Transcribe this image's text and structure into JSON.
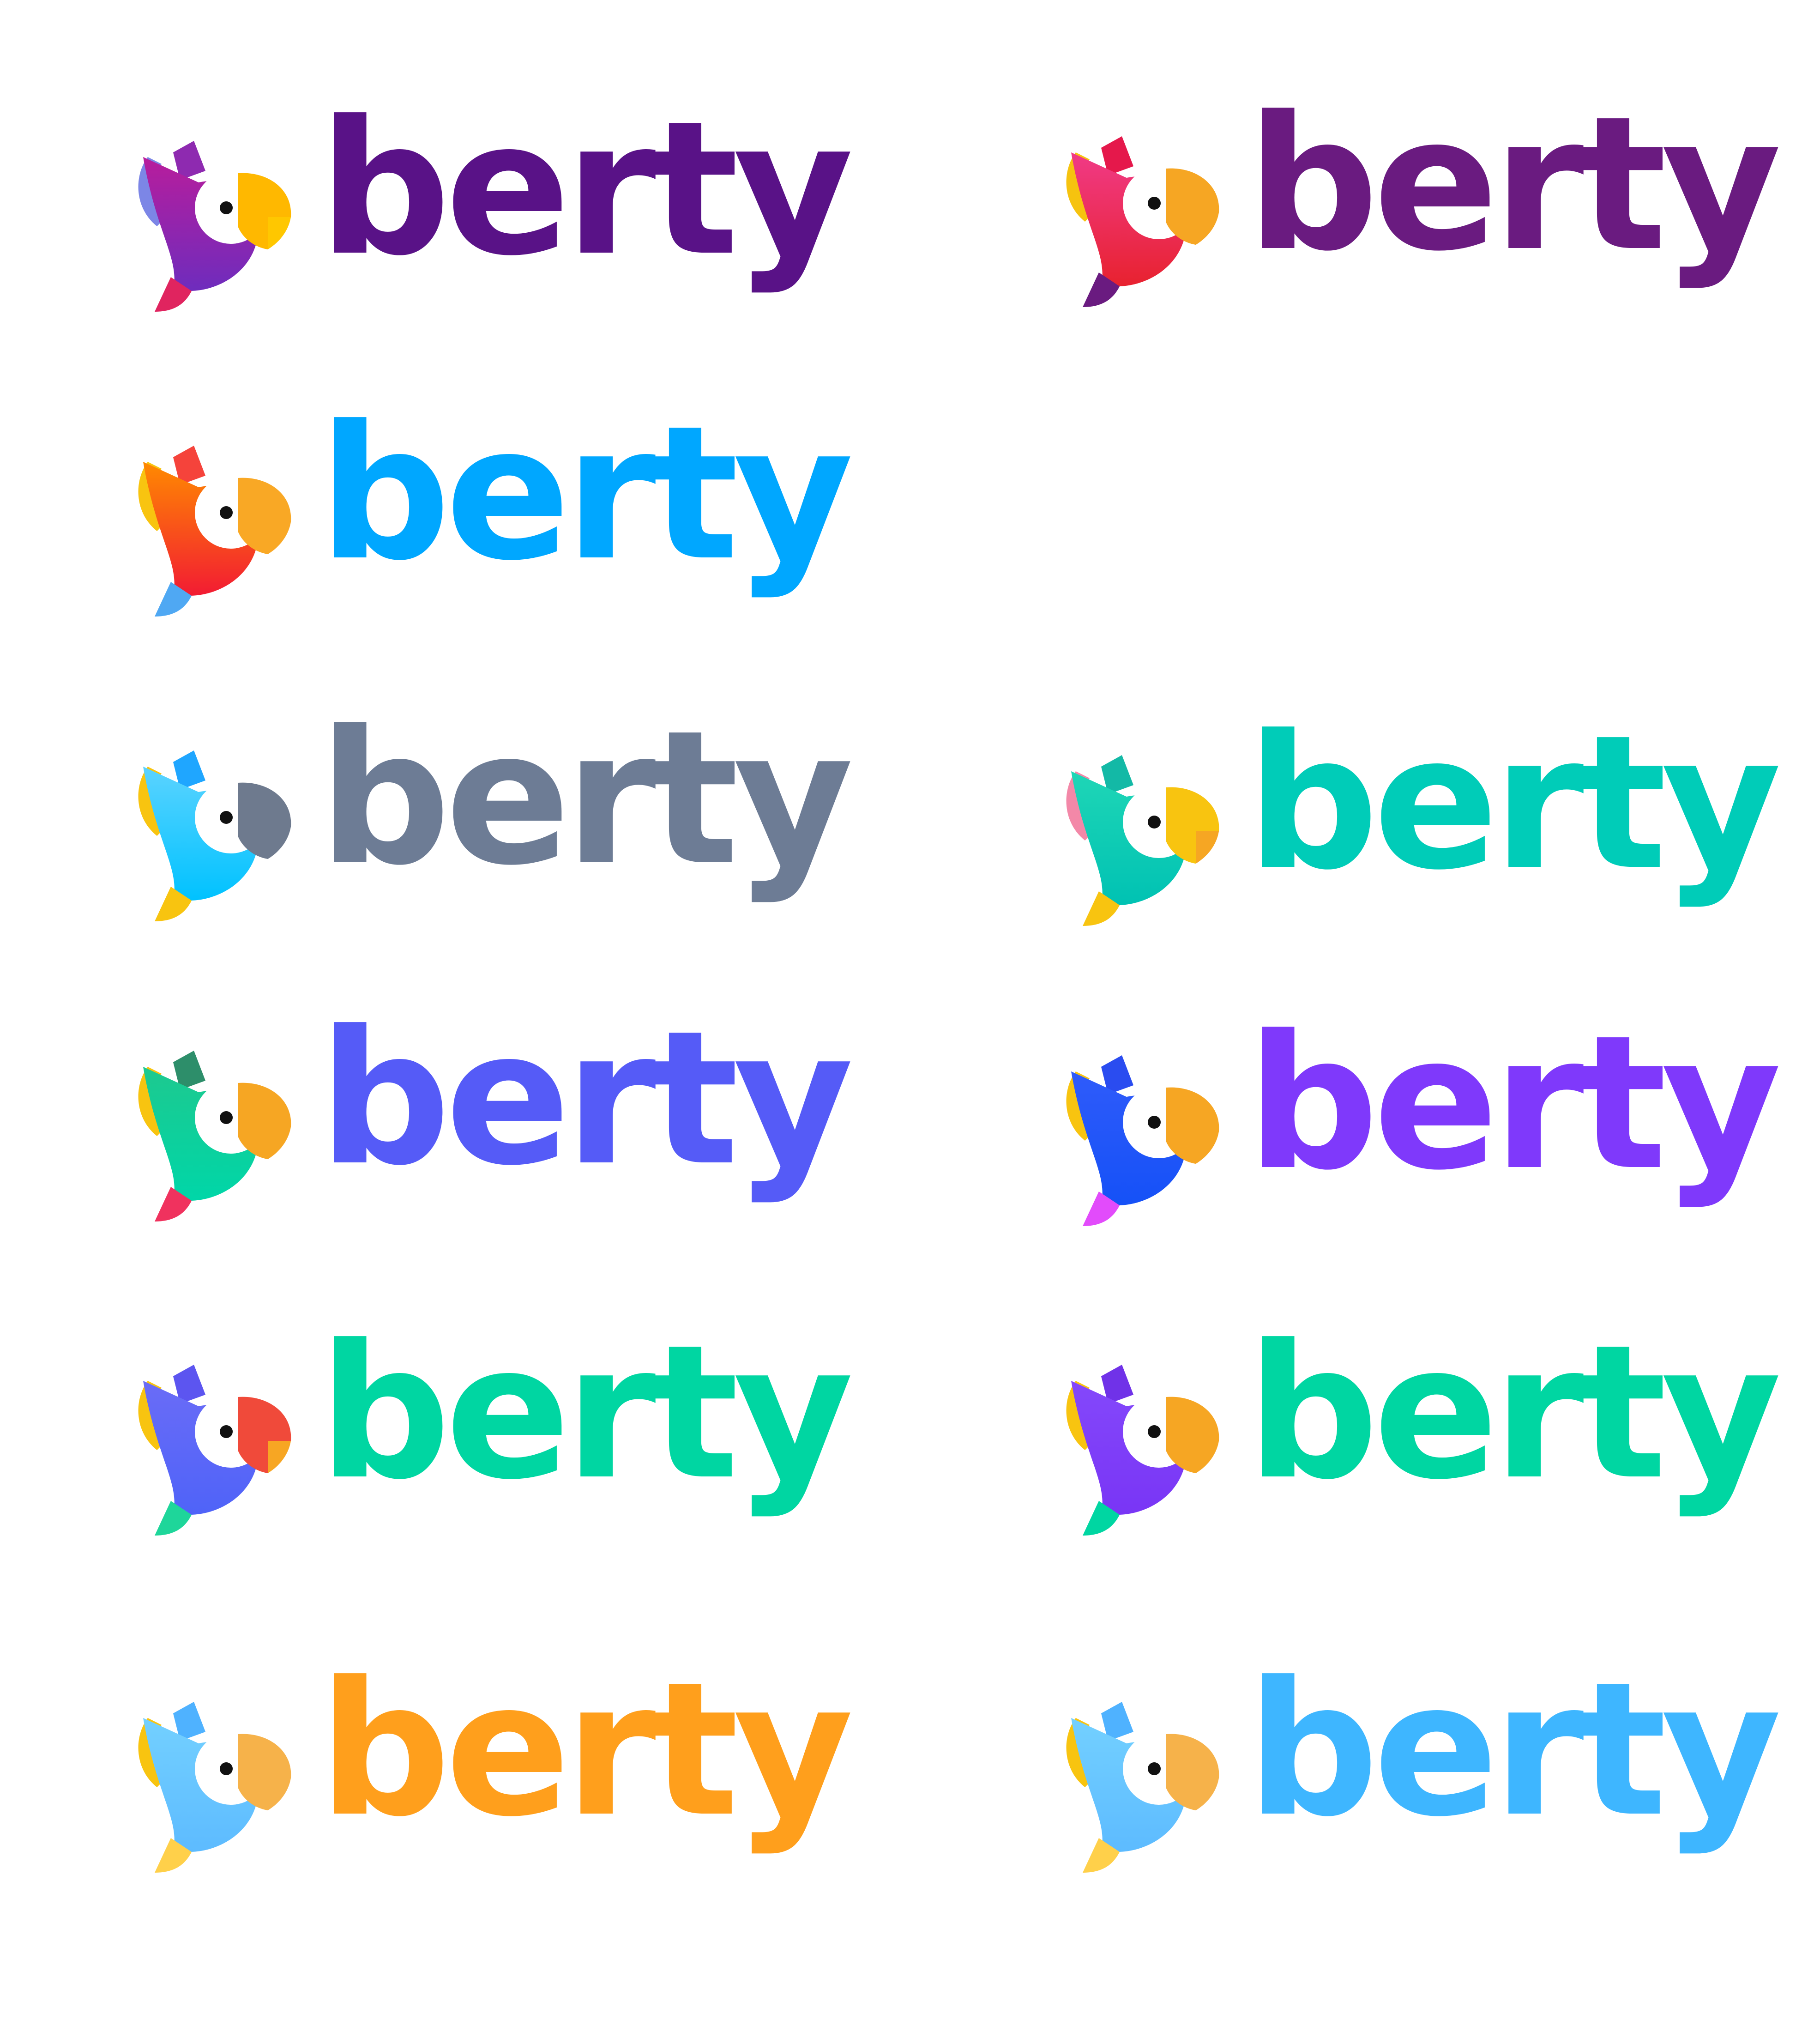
{
  "logos": [
    {
      "text": "berty",
      "text_color": "#591287",
      "body_top": "#B81D9C",
      "body_bottom": "#6E2CBD",
      "wing": "#8E2AB0",
      "crest": "#7C86E6",
      "tail": "#E0245F",
      "beak": "#FFB800",
      "beak_lower": "#FFC700"
    },
    {
      "text": "berty",
      "text_color": "#6A1B80",
      "body_top": "#F03A86",
      "body_bottom": "#E8222F",
      "wing": "#E5184B",
      "crest": "#F6C30F",
      "tail": "#6A1B80",
      "beak": "#F6A623",
      "beak_lower": "#F6A623"
    },
    {
      "text": "berty",
      "text_color": "#00A7FF",
      "body_top": "#FF8A00",
      "body_bottom": "#F21B33",
      "wing": "#F5433B",
      "crest": "#F8C410",
      "tail": "#4FA8F3",
      "beak": "#F9A825",
      "beak_lower": "#F9A825"
    },
    {
      "text": "berty",
      "text_color": "#6D7C95",
      "body_top": "#5BD3FF",
      "body_bottom": "#00C2FF",
      "wing": "#1FA6FF",
      "crest": "#F8C410",
      "tail": "#F8C410",
      "beak": "#6E7A8E",
      "beak_lower": "#6E7A8E"
    },
    {
      "text": "berty",
      "text_color": "#00CCB8",
      "body_top": "#1FD6B6",
      "body_bottom": "#00C2B3",
      "wing": "#13B9A6",
      "crest": "#F388A8",
      "tail": "#F8C410",
      "beak": "#F8C410",
      "beak_lower": "#F6A623"
    },
    {
      "text": "berty",
      "text_color": "#555BF7",
      "body_top": "#1DC98F",
      "body_bottom": "#00D6A8",
      "wing": "#2D8E6A",
      "crest": "#F8C410",
      "tail": "#F0325E",
      "beak": "#F6A623",
      "beak_lower": "#F6A623"
    },
    {
      "text": "berty",
      "text_color": "#7F39FB",
      "body_top": "#2F5BFA",
      "body_bottom": "#1551F7",
      "wing": "#2A4CF0",
      "crest": "#F8C410",
      "tail": "#E24BFB",
      "beak": "#F6A623",
      "beak_lower": "#F6A623"
    },
    {
      "text": "berty",
      "text_color": "#00D6A2",
      "body_top": "#6A6CF7",
      "body_bottom": "#4F63F8",
      "wing": "#5C55F0",
      "crest": "#F8C410",
      "tail": "#1ED69A",
      "beak": "#F04A3A",
      "beak_lower": "#F7A623"
    },
    {
      "text": "berty",
      "text_color": "#00D6A2",
      "body_top": "#8448FB",
      "body_bottom": "#7935F5",
      "wing": "#7032E8",
      "crest": "#F8C410",
      "tail": "#00D6A2",
      "beak": "#F6A623",
      "beak_lower": "#F6A623"
    },
    {
      "text": "berty",
      "text_color": "#FF9F1C",
      "body_top": "#73D0FF",
      "body_bottom": "#5DBBFF",
      "wing": "#4FB2FF",
      "crest": "#F8C410",
      "tail": "#FFD04A",
      "beak": "#F6B24A",
      "beak_lower": "#F6B24A"
    },
    {
      "text": "berty",
      "text_color": "#3EB6FF",
      "body_top": "#73D0FF",
      "body_bottom": "#5DBBFF",
      "wing": "#4FB2FF",
      "crest": "#F8C410",
      "tail": "#FFD04A",
      "beak": "#F6B24A",
      "beak_lower": "#F6B24A"
    }
  ]
}
